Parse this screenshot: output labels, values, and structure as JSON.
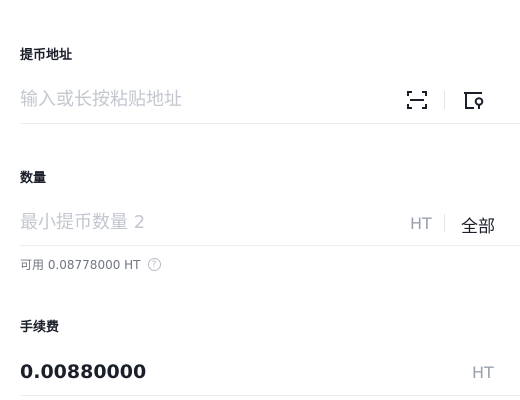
{
  "address": {
    "label": "提币地址",
    "placeholder": "输入或长按粘贴地址",
    "icons": [
      "scan-icon",
      "address-book-icon"
    ]
  },
  "amount": {
    "label": "数量",
    "placeholder": "最小提币数量 2",
    "unit": "HT",
    "all_label": "全部",
    "available_text": "可用 0.08778000 HT",
    "help_icon": "question-circle-icon"
  },
  "fee": {
    "label": "手续费",
    "value": "0.00880000",
    "unit": "HT"
  },
  "colors": {
    "text_primary": "#1b1f2a",
    "placeholder": "#c3c7cf",
    "muted": "#9aa1ac",
    "divider": "#ebedf0",
    "accent": "#3a7bf2"
  }
}
